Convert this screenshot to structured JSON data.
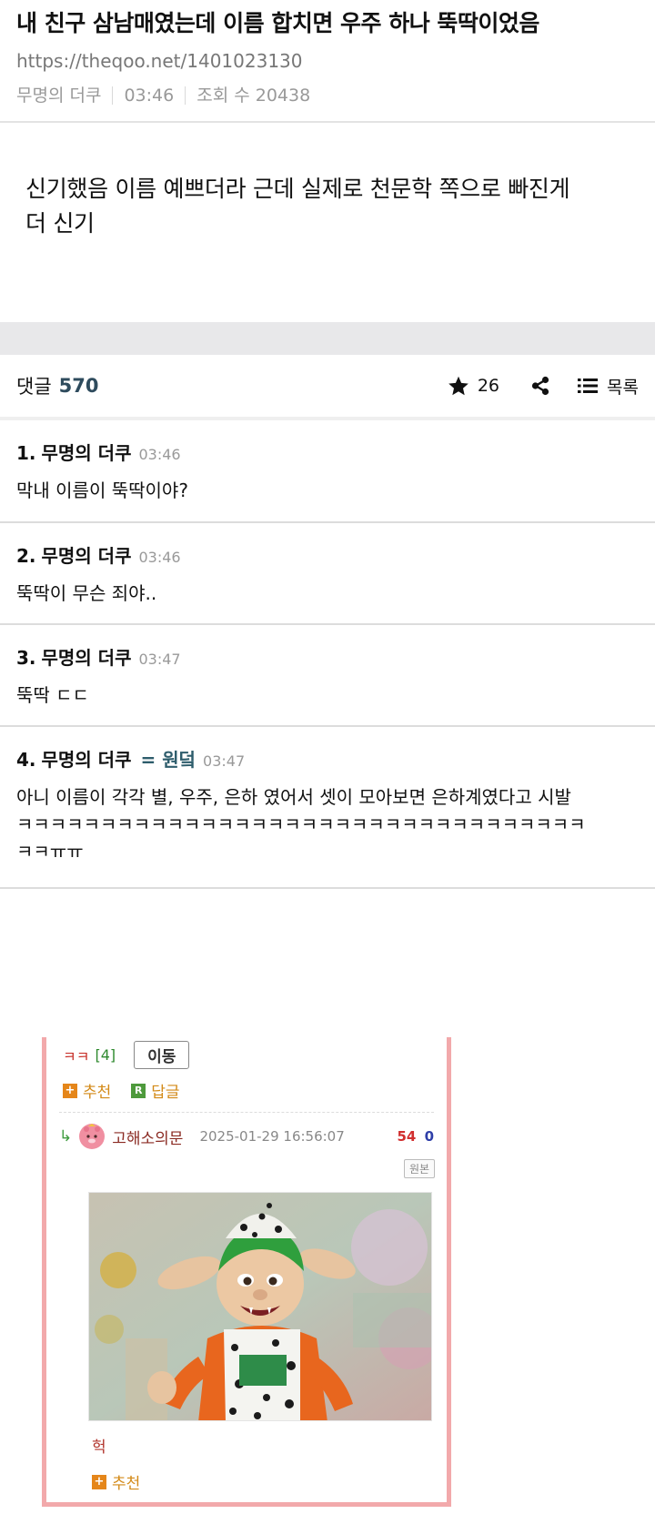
{
  "post": {
    "title": "내 친구 삼남매였는데 이름 합치면 우주 하나 뚝딱이었음",
    "url": "https://theqoo.net/1401023130",
    "author": "무명의 더쿠",
    "time": "03:46",
    "views_label": "조회 수 20438",
    "body_line1": "신기했음 이름 예쁘더라 근데 실제로 천문학 쪽으로 빠진게",
    "body_line2": "더 신기"
  },
  "toolbar": {
    "comments_label": "댓글",
    "comments_count": "570",
    "star_count": "26",
    "list_label": "목록",
    "icons": {
      "star": "star-icon",
      "share": "share-icon",
      "list": "list-icon"
    }
  },
  "comments": [
    {
      "num": "1.",
      "author": "무명의 더쿠",
      "tag": "",
      "time": "03:46",
      "lines": [
        "막내 이름이 뚝딱이야?"
      ]
    },
    {
      "num": "2.",
      "author": "무명의 더쿠",
      "tag": "",
      "time": "03:46",
      "lines": [
        "뚝딱이 무슨 죄야.."
      ]
    },
    {
      "num": "3.",
      "author": "무명의 더쿠",
      "tag": "",
      "time": "03:47",
      "lines": [
        "뚝딱 ㄷㄷ"
      ]
    },
    {
      "num": "4.",
      "author": "무명의 더쿠",
      "tag": "= 원덬",
      "time": "03:47",
      "lines": [
        "아니 이름이 각각 별, 우주, 은하 였어서 셋이 모아보면 은하계였다고 시발",
        "ㅋㅋㅋㅋㅋㅋㅋㅋㅋㅋㅋㅋㅋㅋㅋㅋㅋㅋㅋㅋㅋㅋㅋㅋㅋㅋㅋㅋㅋㅋㅋㅋㅋㅋ",
        "ㅋㅋㅠㅠ"
      ]
    }
  ],
  "embed": {
    "kk_label": "ㅋㅋ",
    "kk_count": "[4]",
    "move_label": "이동",
    "recommend_label": "추천",
    "reply_label": "답글",
    "reply_badge": "R",
    "plus_badge": "+",
    "arrow": "↳",
    "username": "고해소의문",
    "date": "2025-01-29 16:56:07",
    "upvotes": "54",
    "downvotes": "0",
    "original_label": "원본",
    "caption": "헉",
    "recommend_label_2": "추천",
    "colors": {
      "border": "#f2a9ab",
      "orange": "#e5861a",
      "green": "#4e9a3c",
      "red": "#d12f2f",
      "blue": "#2f3fa8"
    }
  }
}
